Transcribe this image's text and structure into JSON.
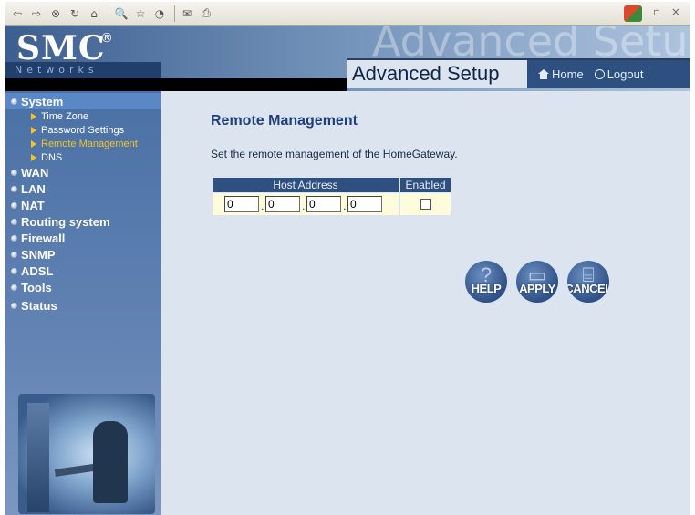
{
  "toolbar": {
    "back": "⇦",
    "forward": "⇨",
    "stop": "⊗",
    "refresh": "↻",
    "home": "⌂",
    "search": "🔍",
    "favorites": "☆",
    "history": "◔",
    "mail": "✉",
    "print": "⎙",
    "window_controls": "– ▫ ×"
  },
  "header": {
    "logo": "SMC",
    "logo_reg": "®",
    "networks": "Networks",
    "bg_title": "Advanced Setup",
    "tab_title": "Advanced Setup",
    "home_label": "Home",
    "logout_label": "Logout"
  },
  "sidebar": {
    "items": [
      {
        "label": "System",
        "active": true
      },
      {
        "label": "WAN"
      },
      {
        "label": "LAN"
      },
      {
        "label": "NAT"
      },
      {
        "label": "Routing system"
      },
      {
        "label": "Firewall"
      },
      {
        "label": "SNMP"
      },
      {
        "label": "ADSL"
      },
      {
        "label": "Tools"
      },
      {
        "label": "Status"
      }
    ],
    "system_subitems": [
      {
        "label": "Time Zone"
      },
      {
        "label": "Password Settings"
      },
      {
        "label": "Remote Management",
        "current": true
      },
      {
        "label": "DNS"
      }
    ]
  },
  "main": {
    "title": "Remote Management",
    "description": "Set the remote management of the HomeGateway.",
    "table": {
      "col_host": "Host Address",
      "col_enabled": "Enabled",
      "ip": [
        "0",
        "0",
        "0",
        "0"
      ],
      "enabled": false
    },
    "buttons": {
      "help": "HELP",
      "apply": "APPLY",
      "cancel": "CANCEL"
    }
  },
  "colors": {
    "accent": "#2d5081",
    "sidebar": "#4a70a4",
    "current_link": "#f3c425",
    "content_bg": "#dbe4ef"
  }
}
